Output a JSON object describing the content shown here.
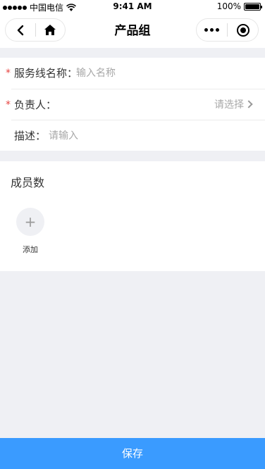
{
  "status_bar": {
    "carrier": "中国电信",
    "time": "9:41 AM",
    "battery": "100%",
    "battery_level": 1.0
  },
  "nav": {
    "title": "产品组",
    "left_buttons": [
      "back-icon",
      "home-icon"
    ],
    "right_buttons": [
      "more-icon",
      "target-icon"
    ]
  },
  "form": {
    "service_name": {
      "label": "服务线名称：",
      "required": true,
      "placeholder": "输入名称",
      "value": ""
    },
    "owner": {
      "label": "负责人：",
      "required": true,
      "value": "请选择"
    },
    "description": {
      "label": "描述：",
      "placeholder": "请输入",
      "value": ""
    }
  },
  "members": {
    "title": "成员数",
    "add_label": "添加",
    "add_icon": "+"
  },
  "footer": {
    "save_label": "保存",
    "accent_color": "#3a9bff"
  }
}
